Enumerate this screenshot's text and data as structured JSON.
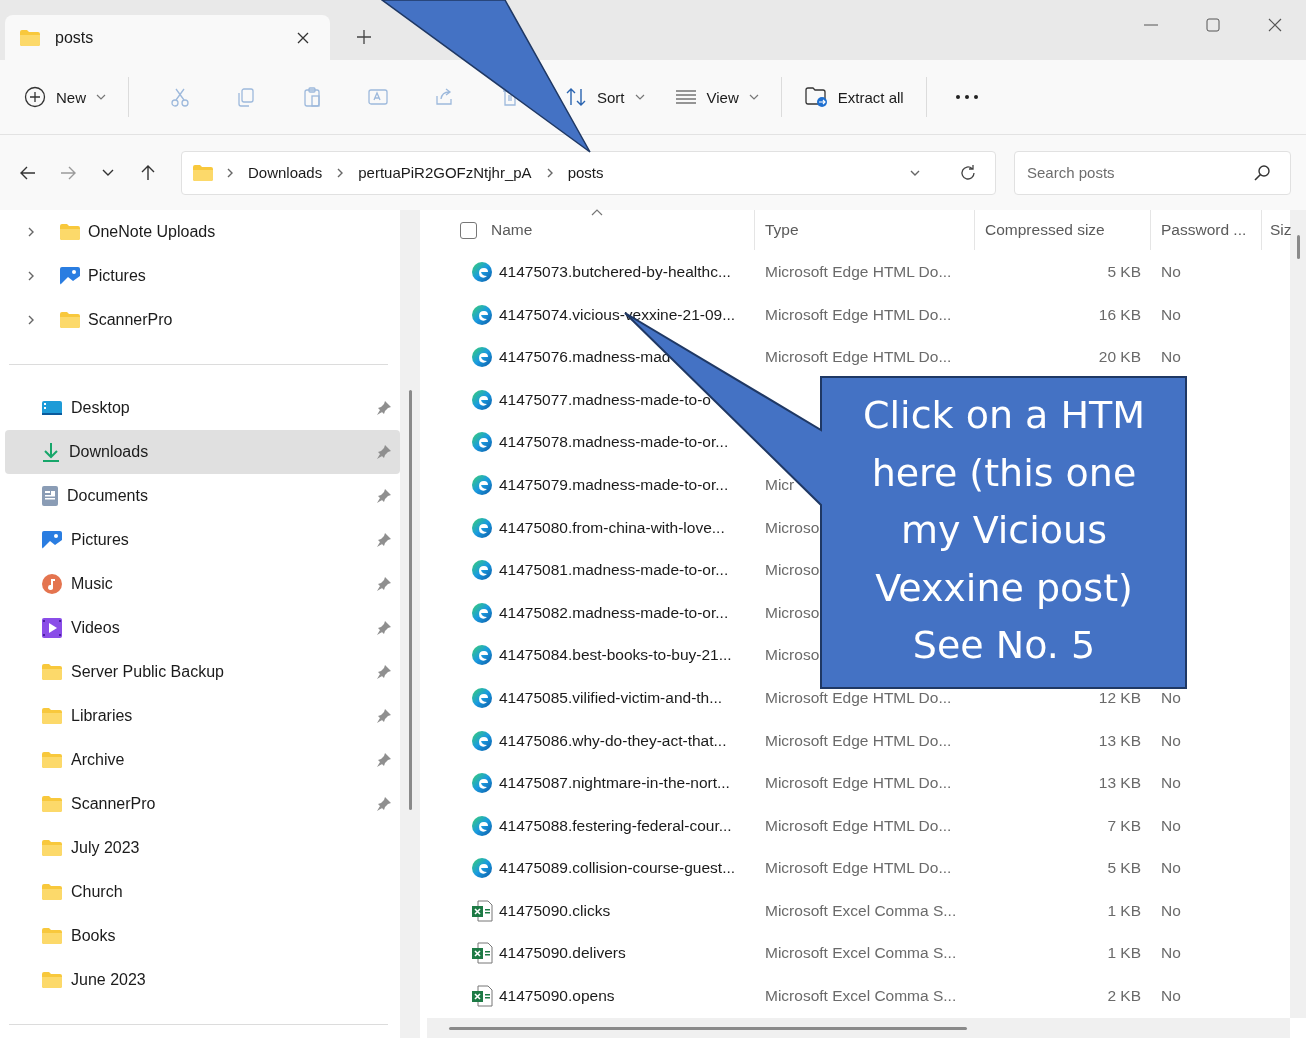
{
  "window": {
    "tab": {
      "title": "posts",
      "selected": true
    }
  },
  "toolbar": {
    "new": "New",
    "actions": [
      {
        "kind": "cut",
        "disabled": true
      },
      {
        "kind": "copy",
        "disabled": true
      },
      {
        "kind": "paste",
        "disabled": true
      },
      {
        "kind": "rename",
        "disabled": true
      },
      {
        "kind": "share",
        "disabled": true
      },
      {
        "kind": "delete",
        "disabled": true
      }
    ],
    "sort": "Sort",
    "view": "View",
    "extract": "Extract all"
  },
  "nav": [
    {
      "kind": "back",
      "disabled": false
    },
    {
      "kind": "forward",
      "disabled": true
    },
    {
      "kind": "recent",
      "disabled": false
    },
    {
      "kind": "up",
      "disabled": false
    }
  ],
  "address": {
    "crumbs": [
      "Downloads",
      "pertuaPiR2GOFzNtjhr_pA",
      "posts"
    ]
  },
  "search": {
    "placeholder": "Search posts"
  },
  "sidebar": {
    "tree": [
      {
        "label": "OneNote Uploads",
        "kind": "folder",
        "expanded": false
      },
      {
        "label": "Pictures",
        "kind": "pictures",
        "expanded": false
      },
      {
        "label": "ScannerPro",
        "kind": "folder",
        "expanded": false
      }
    ],
    "quick_access": [
      {
        "label": "Desktop",
        "kind": "desktop",
        "pinned": true,
        "selected": false
      },
      {
        "label": "Downloads",
        "kind": "downloads",
        "pinned": true,
        "selected": true
      },
      {
        "label": "Documents",
        "kind": "documents",
        "pinned": true,
        "selected": false
      },
      {
        "label": "Pictures",
        "kind": "pictures",
        "pinned": true,
        "selected": false
      },
      {
        "label": "Music",
        "kind": "music",
        "pinned": true,
        "selected": false
      },
      {
        "label": "Videos",
        "kind": "videos",
        "pinned": true,
        "selected": false
      },
      {
        "label": "Server Public Backup",
        "kind": "folder",
        "pinned": true,
        "selected": false
      },
      {
        "label": "Libraries",
        "kind": "folder",
        "pinned": true,
        "selected": false
      },
      {
        "label": "Archive",
        "kind": "folder",
        "pinned": true,
        "selected": false
      },
      {
        "label": "ScannerPro",
        "kind": "folder",
        "pinned": true,
        "selected": false
      },
      {
        "label": "July 2023",
        "kind": "folder",
        "pinned": false,
        "selected": false
      },
      {
        "label": "Church",
        "kind": "folder",
        "pinned": false,
        "selected": false
      },
      {
        "label": "Books",
        "kind": "folder",
        "pinned": false,
        "selected": false
      },
      {
        "label": "June 2023",
        "kind": "folder",
        "pinned": false,
        "selected": false
      }
    ]
  },
  "table": {
    "select_all": {
      "checked": false
    },
    "columns": [
      {
        "label": "Name",
        "sorted": true
      },
      {
        "label": "Type",
        "sorted": false
      },
      {
        "label": "Compressed size",
        "sorted": false
      },
      {
        "label": "Password ...",
        "sorted": false
      },
      {
        "label": "Siz",
        "sorted": false
      }
    ],
    "rows": [
      {
        "kind": "edge",
        "name": "41475073.butchered-by-healthc...",
        "type": "Microsoft Edge HTML Do...",
        "size": "5 KB",
        "password": "No"
      },
      {
        "kind": "edge",
        "name": "41475074.vicious-vexxine-21-09...",
        "type": "Microsoft Edge HTML Do...",
        "size": "16 KB",
        "password": "No"
      },
      {
        "kind": "edge",
        "name": "41475076.madness-mad",
        "type": "Microsoft Edge HTML Do...",
        "size": "20 KB",
        "password": "No"
      },
      {
        "kind": "edge",
        "name": "41475077.madness-made-to-o"
      },
      {
        "kind": "edge",
        "name": "41475078.madness-made-to-or..."
      },
      {
        "kind": "edge",
        "name": "41475079.madness-made-to-or...",
        "type": "Micr"
      },
      {
        "kind": "edge",
        "name": "41475080.from-china-with-love...",
        "type": "Microso"
      },
      {
        "kind": "edge",
        "name": "41475081.madness-made-to-or...",
        "type": "Microso"
      },
      {
        "kind": "edge",
        "name": "41475082.madness-made-to-or...",
        "type": "Microso"
      },
      {
        "kind": "edge",
        "name": "41475084.best-books-to-buy-21...",
        "type": "Microso"
      },
      {
        "kind": "edge",
        "name": "41475085.vilified-victim-and-th...",
        "type": "Microsoft Edge HTML Do...",
        "size": "12 KB",
        "password": "No"
      },
      {
        "kind": "edge",
        "name": "41475086.why-do-they-act-that...",
        "type": "Microsoft Edge HTML Do...",
        "size": "13 KB",
        "password": "No"
      },
      {
        "kind": "edge",
        "name": "41475087.nightmare-in-the-nort...",
        "type": "Microsoft Edge HTML Do...",
        "size": "13 KB",
        "password": "No"
      },
      {
        "kind": "edge",
        "name": "41475088.festering-federal-cour...",
        "type": "Microsoft Edge HTML Do...",
        "size": "7 KB",
        "password": "No"
      },
      {
        "kind": "edge",
        "name": "41475089.collision-course-guest...",
        "type": "Microsoft Edge HTML Do...",
        "size": "5 KB",
        "password": "No"
      },
      {
        "kind": "excel",
        "name": "41475090.clicks",
        "type": "Microsoft Excel Comma S...",
        "size": "1 KB",
        "password": "No"
      },
      {
        "kind": "excel",
        "name": "41475090.delivers",
        "type": "Microsoft Excel Comma S...",
        "size": "1 KB",
        "password": "No"
      },
      {
        "kind": "excel",
        "name": "41475090.opens",
        "type": "Microsoft Excel Comma S...",
        "size": "2 KB",
        "password": "No"
      }
    ]
  },
  "callout": {
    "text": "Click on a HTM\nhere (this one\nmy Vicious\nVexxine post)\nSee No. 5"
  }
}
